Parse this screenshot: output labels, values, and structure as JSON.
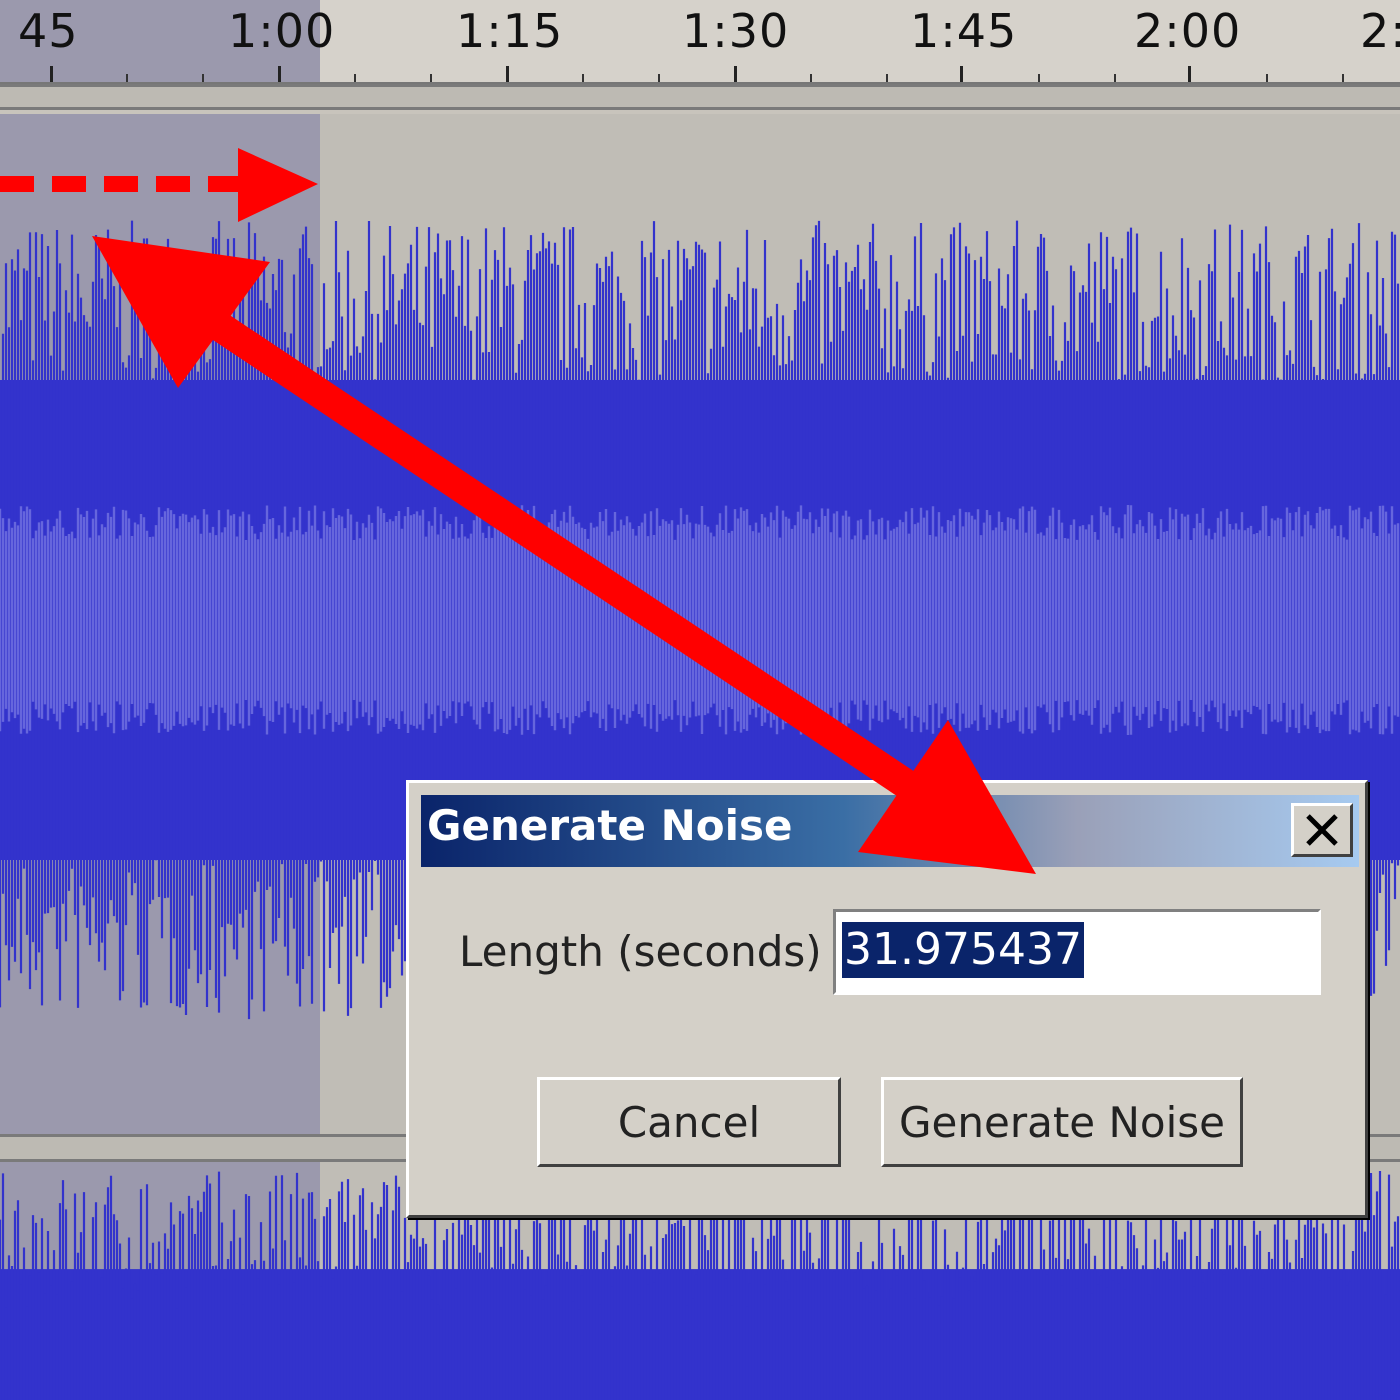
{
  "ruler": {
    "labels": [
      "45",
      "1:00",
      "1:15",
      "1:30",
      "1:45",
      "2:00",
      "2:"
    ]
  },
  "dialog": {
    "title": "Generate Noise",
    "close_icon": "close-icon",
    "length_label": "Length (seconds)",
    "length_value": "31.975437",
    "cancel_label": "Cancel",
    "generate_label": "Generate Noise"
  },
  "colors": {
    "waveform": "#3333cc",
    "waveform_rms": "#6666dd",
    "selection": "#9b99ad",
    "annotation": "#ff0000",
    "titlebar_start": "#0a246a",
    "titlebar_end": "#a6caf0"
  },
  "annotations": {
    "arrow_dashed_icon": "dashed-arrow-right-icon",
    "arrow_double_icon": "double-headed-arrow-icon"
  }
}
